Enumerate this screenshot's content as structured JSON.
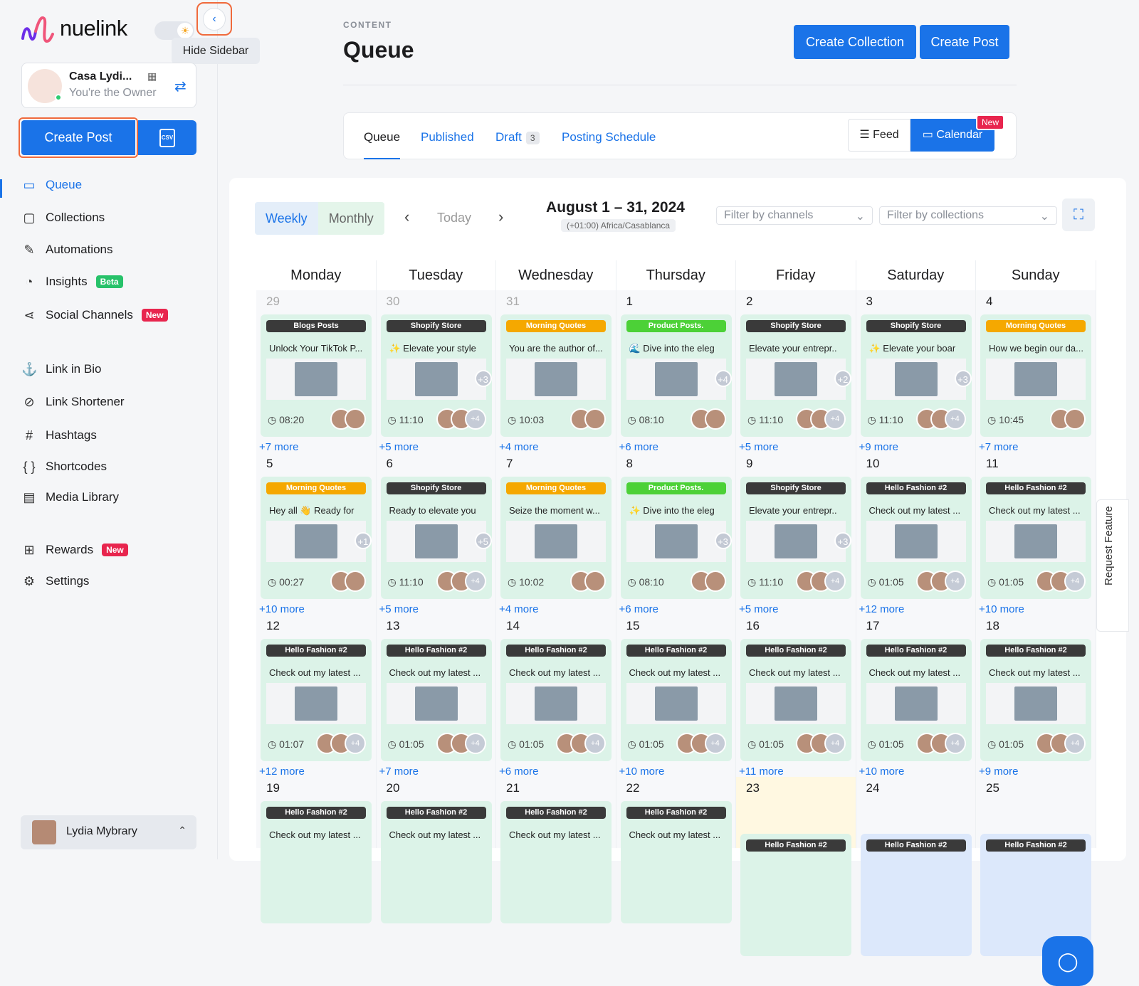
{
  "brand": {
    "name": "nuelink"
  },
  "tooltip": "Hide Sidebar",
  "account": {
    "name": "Casa Lydi...",
    "role": "You're the Owner"
  },
  "sidebar": {
    "create_post": "Create Post",
    "csv_label": "CSV",
    "items": [
      {
        "label": "Queue",
        "icon": "calendar-icon"
      },
      {
        "label": "Collections",
        "icon": "folder-icon"
      },
      {
        "label": "Automations",
        "icon": "magic-wand-icon"
      },
      {
        "label": "Insights",
        "icon": "pie-chart-icon",
        "badge": "Beta"
      },
      {
        "label": "Social Channels",
        "icon": "share-icon",
        "badge": "New"
      },
      {
        "label": "Link in Bio",
        "icon": "anchor-icon"
      },
      {
        "label": "Link Shortener",
        "icon": "link-icon"
      },
      {
        "label": "Hashtags",
        "icon": "hashtag-icon"
      },
      {
        "label": "Shortcodes",
        "icon": "braces-icon"
      },
      {
        "label": "Media Library",
        "icon": "images-icon"
      },
      {
        "label": "Rewards",
        "icon": "gift-icon",
        "badge": "New"
      },
      {
        "label": "Settings",
        "icon": "gear-icon"
      }
    ],
    "user": "Lydia Mybrary"
  },
  "header": {
    "crumb": "CONTENT",
    "title": "Queue",
    "create_collection": "Create Collection",
    "create_post": "Create Post"
  },
  "tabs": {
    "queue": "Queue",
    "published": "Published",
    "draft": "Draft",
    "draft_count": "3",
    "schedule": "Posting Schedule",
    "feed": "Feed",
    "calendar": "Calendar",
    "new": "New"
  },
  "toolbar": {
    "weekly": "Weekly",
    "monthly": "Monthly",
    "today": "Today",
    "range": "August 1 – 31, 2024",
    "tz": "(+01:00) Africa/Casablanca",
    "filter_channels": "Filter by channels",
    "filter_collections": "Filter by collections"
  },
  "days": [
    "Monday",
    "Tuesday",
    "Wednesday",
    "Thursday",
    "Friday",
    "Saturday",
    "Sunday"
  ],
  "weeks": [
    [
      {
        "d": "29",
        "faded": true,
        "tag": "Blogs Posts",
        "tagc": "#3a3a3a",
        "txt": "Unlock Your TikTok P...",
        "time": "08:20",
        "plus": "",
        "more": "+7 more"
      },
      {
        "d": "30",
        "faded": true,
        "tag": "Shopify Store",
        "tagc": "#3a3a3a",
        "txt": "✨ Elevate your style",
        "time": "11:10",
        "plus": "+3",
        "more": "+5 more"
      },
      {
        "d": "31",
        "faded": true,
        "tag": "Morning Quotes",
        "tagc": "#f5a800",
        "txt": "You are the author of...",
        "time": "10:03",
        "plus": "",
        "more": "+4 more"
      },
      {
        "d": "1",
        "tag": "Product Posts.",
        "tagc": "#4cd137",
        "txt": "🌊 Dive into the eleg",
        "time": "08:10",
        "plus": "+4",
        "more": "+6 more"
      },
      {
        "d": "2",
        "tag": "Shopify Store",
        "tagc": "#3a3a3a",
        "txt": "Elevate your entrepr..",
        "time": "11:10",
        "plus": "+2",
        "more": "+5 more"
      },
      {
        "d": "3",
        "tag": "Shopify Store",
        "tagc": "#3a3a3a",
        "txt": "✨ Elevate your boar",
        "time": "11:10",
        "plus": "+3",
        "more": "+9 more"
      },
      {
        "d": "4",
        "tag": "Morning Quotes",
        "tagc": "#f5a800",
        "txt": "How we begin our da...",
        "time": "10:45",
        "plus": "",
        "more": "+7 more"
      }
    ],
    [
      {
        "d": "5",
        "tag": "Morning Quotes",
        "tagc": "#f5a800",
        "txt": "Hey all 👋 Ready for",
        "time": "00:27",
        "plus": "+1",
        "more": "+10 more"
      },
      {
        "d": "6",
        "tag": "Shopify Store",
        "tagc": "#3a3a3a",
        "txt": "Ready to elevate you",
        "time": "11:10",
        "plus": "+5",
        "more": "+5 more"
      },
      {
        "d": "7",
        "tag": "Morning Quotes",
        "tagc": "#f5a800",
        "txt": "Seize the moment w...",
        "time": "10:02",
        "plus": "",
        "more": "+4 more"
      },
      {
        "d": "8",
        "tag": "Product Posts.",
        "tagc": "#4cd137",
        "txt": "✨ Dive into the eleg",
        "time": "08:10",
        "plus": "+3",
        "more": "+6 more"
      },
      {
        "d": "9",
        "tag": "Shopify Store",
        "tagc": "#3a3a3a",
        "txt": "Elevate your entrepr..",
        "time": "11:10",
        "plus": "+3",
        "more": "+5 more"
      },
      {
        "d": "10",
        "tag": "Hello Fashion #2",
        "tagc": "#3a3a3a",
        "txt": "Check out my latest ...",
        "time": "01:05",
        "plus": "",
        "more": "+12 more"
      },
      {
        "d": "11",
        "tag": "Hello Fashion #2",
        "tagc": "#3a3a3a",
        "txt": "Check out my latest ...",
        "time": "01:05",
        "plus": "",
        "more": "+10 more"
      }
    ],
    [
      {
        "d": "12",
        "tag": "Hello Fashion #2",
        "tagc": "#3a3a3a",
        "txt": "Check out my latest ...",
        "time": "01:07",
        "plus": "",
        "more": "+12 more"
      },
      {
        "d": "13",
        "tag": "Hello Fashion #2",
        "tagc": "#3a3a3a",
        "txt": "Check out my latest ...",
        "time": "01:05",
        "plus": "",
        "more": "+7 more"
      },
      {
        "d": "14",
        "tag": "Hello Fashion #2",
        "tagc": "#3a3a3a",
        "txt": "Check out my latest ...",
        "time": "01:05",
        "plus": "",
        "more": "+6 more"
      },
      {
        "d": "15",
        "tag": "Hello Fashion #2",
        "tagc": "#3a3a3a",
        "txt": "Check out my latest ...",
        "time": "01:05",
        "plus": "",
        "more": "+10 more"
      },
      {
        "d": "16",
        "tag": "Hello Fashion #2",
        "tagc": "#3a3a3a",
        "txt": "Check out my latest ...",
        "time": "01:05",
        "plus": "",
        "more": "+11 more"
      },
      {
        "d": "17",
        "tag": "Hello Fashion #2",
        "tagc": "#3a3a3a",
        "txt": "Check out my latest ...",
        "time": "01:05",
        "plus": "",
        "more": "+10 more"
      },
      {
        "d": "18",
        "tag": "Hello Fashion #2",
        "tagc": "#3a3a3a",
        "txt": "Check out my latest ...",
        "time": "01:05",
        "plus": "",
        "more": "+9 more"
      }
    ],
    [
      {
        "d": "19",
        "tag": "Hello Fashion #2",
        "tagc": "#3a3a3a",
        "txt": "Check out my latest ...",
        "time": "",
        "plus": "",
        "more": ""
      },
      {
        "d": "20",
        "tag": "Hello Fashion #2",
        "tagc": "#3a3a3a",
        "txt": "Check out my latest ...",
        "time": "",
        "plus": "",
        "more": ""
      },
      {
        "d": "21",
        "tag": "Hello Fashion #2",
        "tagc": "#3a3a3a",
        "txt": "Check out my latest ...",
        "time": "",
        "plus": "",
        "more": ""
      },
      {
        "d": "22",
        "tag": "Hello Fashion #2",
        "tagc": "#3a3a3a",
        "txt": "Check out my latest ...",
        "time": "",
        "plus": "",
        "more": ""
      },
      {
        "d": "23",
        "tag": "Hello Fashion #2",
        "tagc": "#3a3a3a",
        "txt": "",
        "time": "",
        "plus": "",
        "more": "",
        "today": true
      },
      {
        "d": "24",
        "tag": "Hello Fashion #2",
        "tagc": "#3a3a3a",
        "txt": "",
        "time": "",
        "plus": "",
        "more": ""
      },
      {
        "d": "25",
        "tag": "Hello Fashion #2",
        "tagc": "#3a3a3a",
        "txt": "",
        "time": "",
        "plus": "",
        "more": ""
      }
    ]
  ],
  "avatar_count": "+4",
  "request_feature": "Request Feature"
}
